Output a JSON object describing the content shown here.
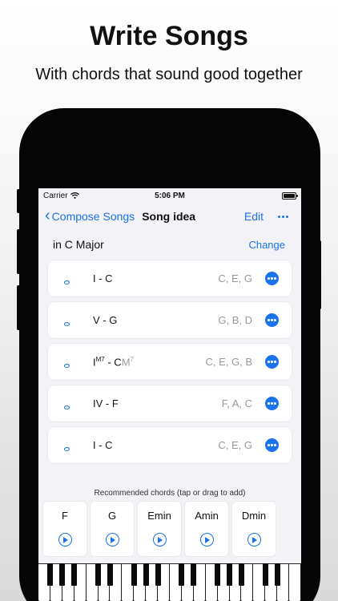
{
  "promo": {
    "headline": "Write Songs",
    "subline": "With chords that sound good together"
  },
  "status_bar": {
    "carrier": "Carrier",
    "time": "5:06 PM"
  },
  "nav": {
    "back_label": "Compose Songs",
    "title": "Song idea",
    "edit_label": "Edit"
  },
  "key": {
    "label": "in C Major",
    "change_label": "Change"
  },
  "progression": [
    {
      "numeral": "I - C",
      "numeral_sup": "",
      "ghost": "",
      "ghost_sup": "",
      "notes": "C, E, G"
    },
    {
      "numeral": "V - G",
      "numeral_sup": "",
      "ghost": "",
      "ghost_sup": "",
      "notes": "G, B, D"
    },
    {
      "numeral": "I",
      "numeral_sup": "M7",
      "numeral_tail": " - C",
      "ghost": "M",
      "ghost_sup": "7",
      "notes": "C, E, G, B"
    },
    {
      "numeral": "IV - F",
      "numeral_sup": "",
      "ghost": "",
      "ghost_sup": "",
      "notes": "F, A, C"
    },
    {
      "numeral": "I - C",
      "numeral_sup": "",
      "ghost": "",
      "ghost_sup": "",
      "notes": "C, E, G"
    }
  ],
  "recommended": {
    "label": "Recommended chords (tap or drag to add)",
    "chords": [
      "F",
      "G",
      "Emin",
      "Amin",
      "Dmin"
    ]
  },
  "colors": {
    "accent": "#1a73e8",
    "screen_bg": "#f2f2f7"
  }
}
